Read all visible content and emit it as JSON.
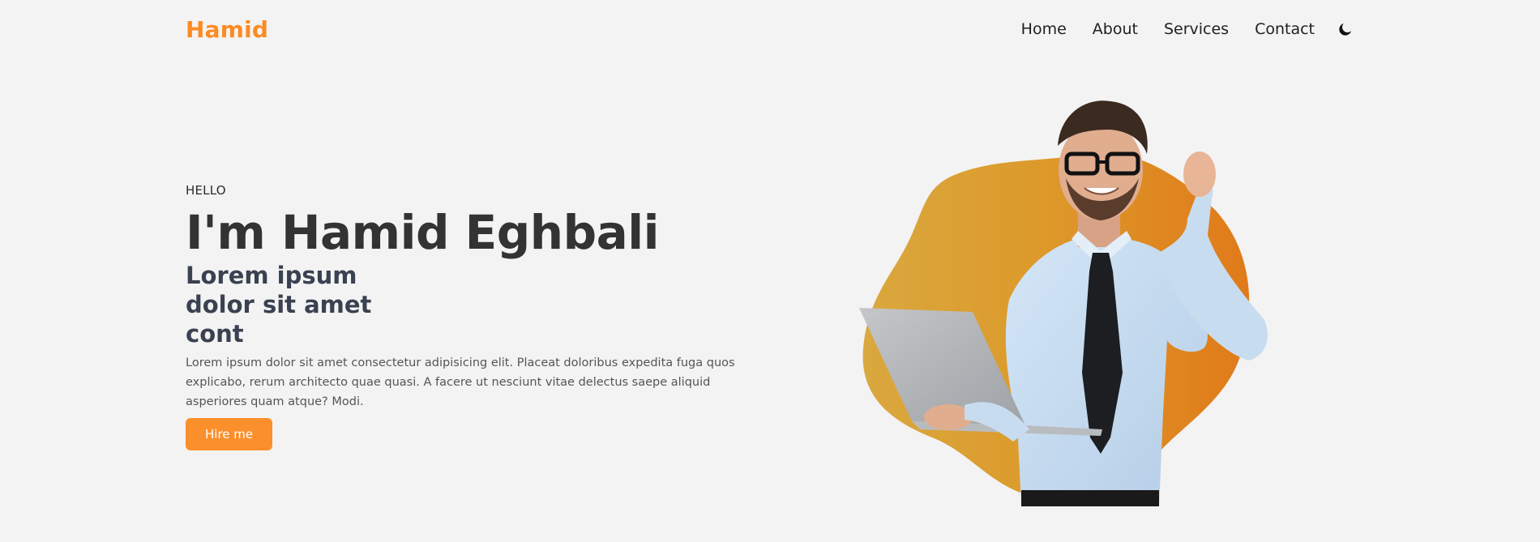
{
  "header": {
    "logo": "Hamid",
    "nav": [
      {
        "label": "Home"
      },
      {
        "label": "About"
      },
      {
        "label": "Services"
      },
      {
        "label": "Contact"
      }
    ],
    "theme_icon": "moon-icon"
  },
  "hero": {
    "greeting": "HELLO",
    "title": "I'm Hamid Eghbali",
    "subtitle": "Lorem ipsum dolor sit amet cont",
    "description": "Lorem ipsum dolor sit amet consectetur adipisicing elit. Placeat doloribus expedita fuga quos explicabo, rerum architecto quae quasi. A facere ut nesciunt vitae delectus saepe aliquid asperiores quam atque? Modi.",
    "cta_label": "Hire me",
    "image": "portrait of a smiling man in glasses holding a laptop, over an orange blob"
  },
  "colors": {
    "accent": "#fb8b24",
    "background": "#f3f3f3",
    "text": "#333333"
  }
}
